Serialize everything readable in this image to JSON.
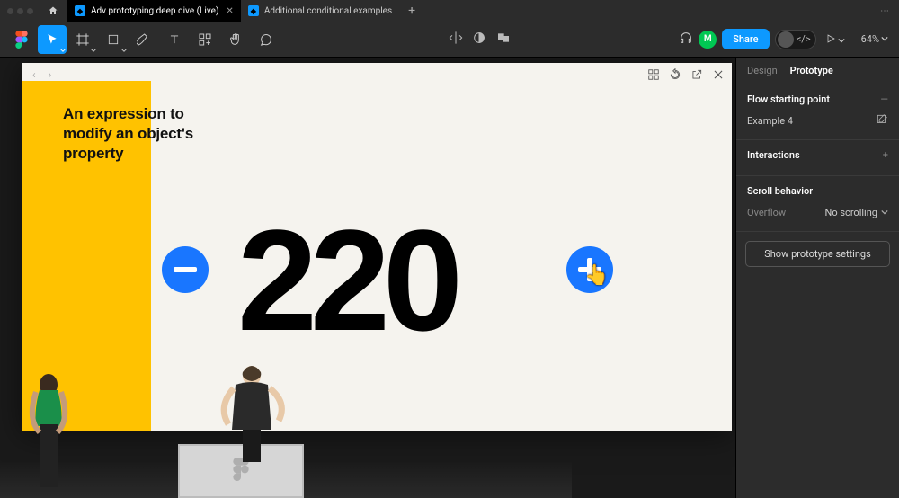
{
  "tabs": {
    "active": "Adv prototyping deep dive (Live)",
    "inactive": "Additional conditional examples"
  },
  "toolbar": {
    "zoom": "64%"
  },
  "share": {
    "label": "Share",
    "avatar_initial": "M"
  },
  "presentation": {
    "title": "An expression to modify an object's property",
    "counter_value": "220"
  },
  "panel": {
    "tabs": {
      "design": "Design",
      "prototype": "Prototype"
    },
    "flow": {
      "heading": "Flow starting point",
      "name": "Example 4"
    },
    "interactions": {
      "heading": "Interactions"
    },
    "scroll": {
      "heading": "Scroll behavior",
      "overflow_label": "Overflow",
      "overflow_value": "No scrolling"
    },
    "show_settings": "Show prototype settings"
  }
}
